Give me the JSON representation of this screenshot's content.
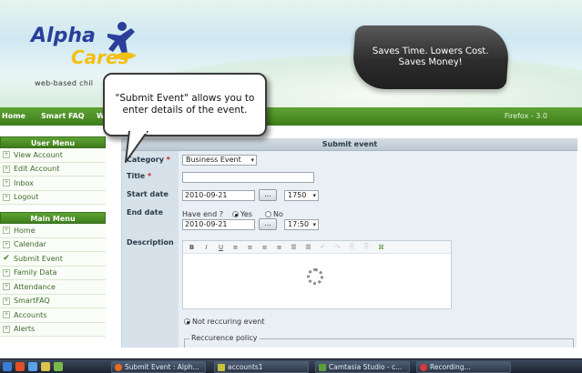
{
  "header": {
    "logo_alpha": "Alpha",
    "logo_cares": "Cares",
    "logo_tagline": "web-based chil",
    "slogan_line1": "Saves Time. Lowers Cost.",
    "slogan_line2": "Saves Money!"
  },
  "topnav": {
    "items": [
      "Home",
      "Smart FAQ",
      "W"
    ],
    "browser_label": "Firefox - 3.0"
  },
  "user_menu": {
    "title": "User Menu",
    "items": [
      "View Account",
      "Edit Account",
      "Inbox",
      "Logout"
    ]
  },
  "main_menu": {
    "title": "Main Menu",
    "items": [
      "Home",
      "Calendar",
      "Submit Event",
      "Family Data",
      "Attendance",
      "SmartFAQ",
      "Accounts",
      "Alerts"
    ]
  },
  "form": {
    "title": "Submit event",
    "category_label": "Category",
    "category_value": "Business Event",
    "title_label": "Title",
    "start_label": "Start date",
    "start_date": "2010-09-21",
    "start_time": "1750",
    "end_label": "End date",
    "have_end_label": "Have end ?",
    "yes_label": "Yes",
    "no_label": "No",
    "end_date": "2010-09-21",
    "end_time": "17:50",
    "description_label": "Description",
    "picker_button": "...",
    "not_recurring_label": "Not reccuring event",
    "recurrence_legend": "Reccurence policy",
    "required_mark": "*"
  },
  "editor_toolbar": [
    "B",
    "I",
    "U",
    "≡",
    "≡",
    "≡",
    "≡",
    "☰",
    "☰",
    "↶",
    "↷",
    "⎘",
    "⎘",
    "⌘"
  ],
  "callout": {
    "text": "\"Submit Event\" allows you to enter details of the event."
  },
  "taskbar": {
    "tasks": [
      "Submit Event : Alph...",
      "accounts1",
      "Camtasia Studio - c...",
      "Recording..."
    ]
  },
  "colors": {
    "nav_green": "#3e7d1b",
    "menu_text": "#3d6a2b",
    "required": "#d01c1c"
  }
}
